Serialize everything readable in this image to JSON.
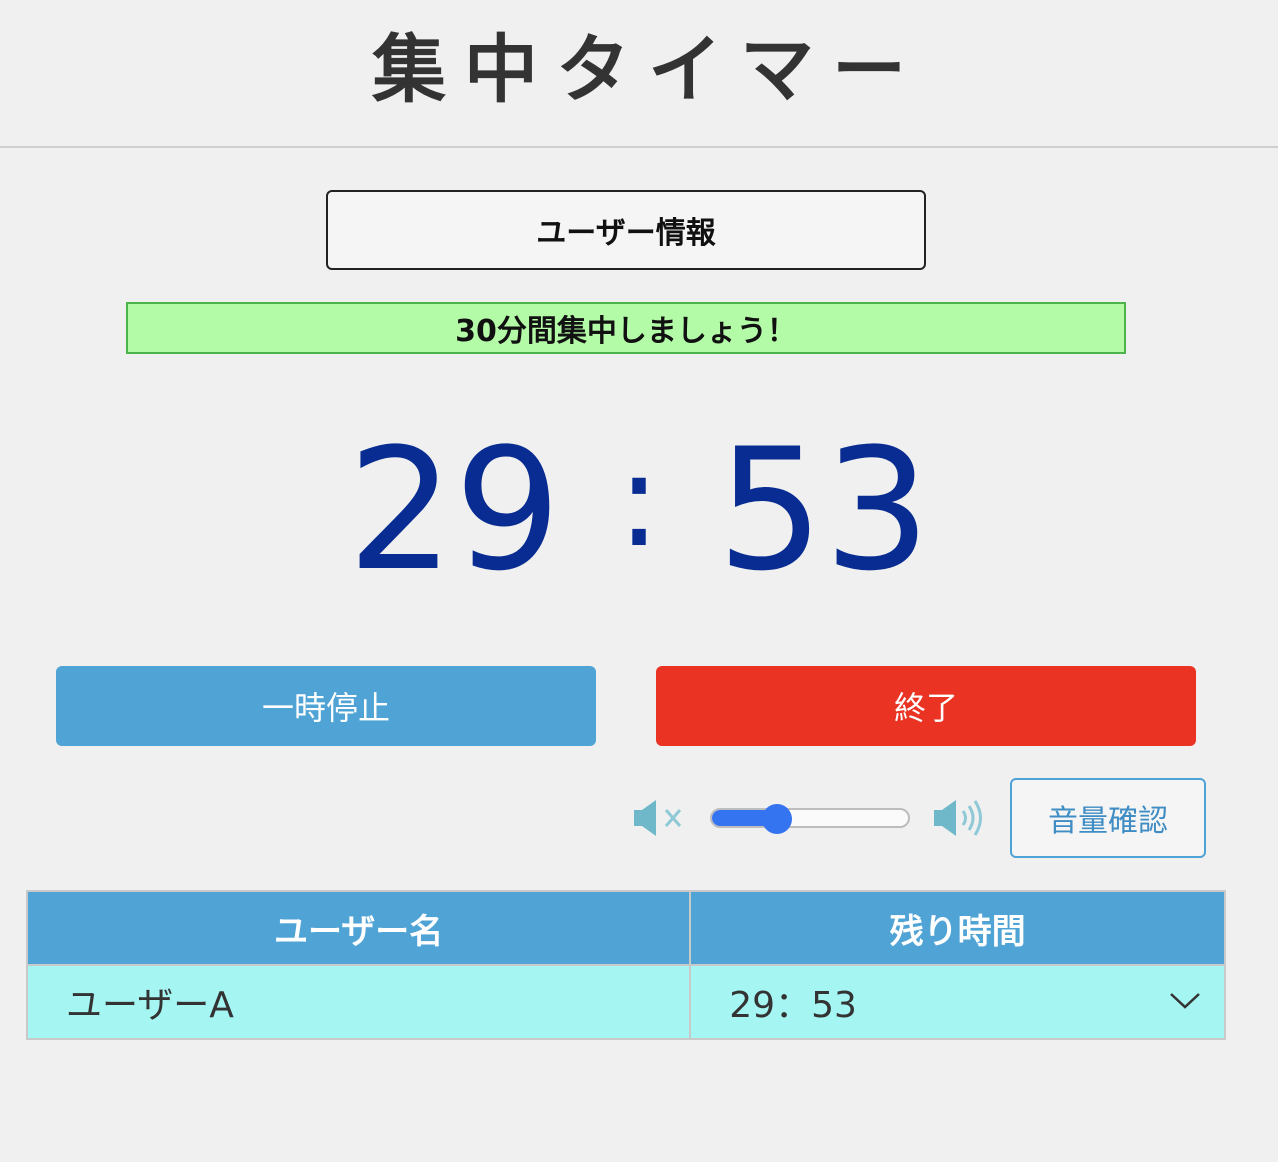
{
  "header": {
    "title": "集中タイマー"
  },
  "user_info_button": {
    "label": "ユーザー情報"
  },
  "message": {
    "text": "30分間集中しましょう！"
  },
  "timer": {
    "minutes": "29",
    "separator": ":",
    "seconds": "53"
  },
  "actions": {
    "pause_label": "一時停止",
    "end_label": "終了"
  },
  "volume": {
    "mute_icon": "speaker-mute-icon",
    "loud_icon": "speaker-loud-icon",
    "level_percent": 33,
    "check_label": "音量確認"
  },
  "table": {
    "headers": [
      "ユーザー名",
      "残り時間"
    ],
    "rows": [
      {
        "name": "ユーザーA",
        "remaining": "29：53"
      }
    ],
    "expand_icon": "chevron-down-icon"
  },
  "colors": {
    "timer": "#082c91",
    "pause": "#50a3d5",
    "end": "#ea3323",
    "message_bg": "#b3fba6",
    "table_header": "#50a3d5",
    "table_row": "#a5f5f3"
  }
}
